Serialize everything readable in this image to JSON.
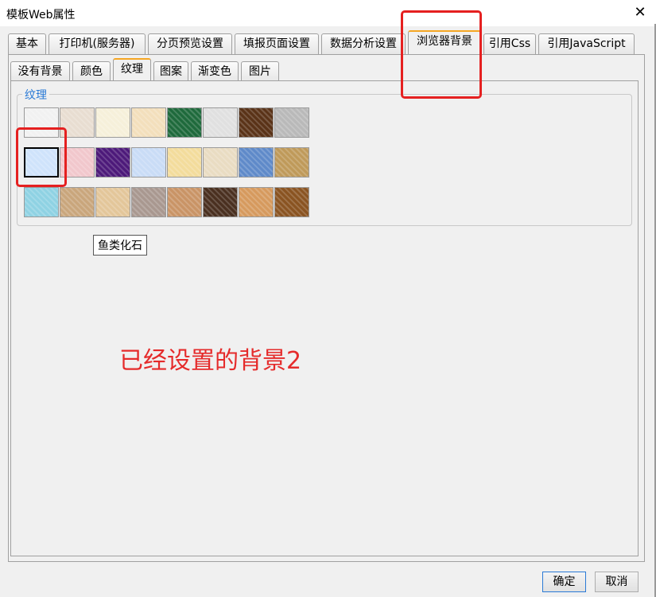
{
  "window": {
    "title": "模板Web属性"
  },
  "main_tabs": [
    "基本",
    "打印机(服务器)",
    "分页预览设置",
    "填报页面设置",
    "数据分析设置",
    "浏览器背景",
    "引用Css",
    "引用JavaScript"
  ],
  "main_tabs_active": "浏览器背景",
  "sub_tabs": [
    "没有背景",
    "颜色",
    "纹理",
    "图案",
    "渐变色",
    "图片"
  ],
  "sub_tabs_active": "纹理",
  "group": {
    "label": "纹理"
  },
  "textures": {
    "rows": [
      [
        "#f1f1f1",
        "#e8ddd1",
        "#f6f0da",
        "#f3dfbc",
        "#1f6a3c",
        "#e0e0e0",
        "#5a3318",
        "#b9b9b9"
      ],
      [
        "#cfe3fb",
        "#f1c7cc",
        "#4d1a7a",
        "#c9dcf6",
        "#f3dc9c",
        "#e9dcc2",
        "#5f8ac9",
        "#bf9a5a"
      ],
      [
        "#8fd2e3",
        "#c9a67c",
        "#e3c69a",
        "#a99890",
        "#c99466",
        "#4a3020",
        "#d69a5e",
        "#8a5422"
      ]
    ],
    "selected_index": [
      1,
      0
    ]
  },
  "tooltip": "鱼类化石",
  "annotation": "已经设置的背景2",
  "buttons": {
    "ok": "确定",
    "cancel": "取消"
  },
  "colors": {
    "annotation": "#e52b2b",
    "highlight_box": "#e52020",
    "accent": "#2a7ad6",
    "active_tab_stripe": "#f5a623"
  }
}
